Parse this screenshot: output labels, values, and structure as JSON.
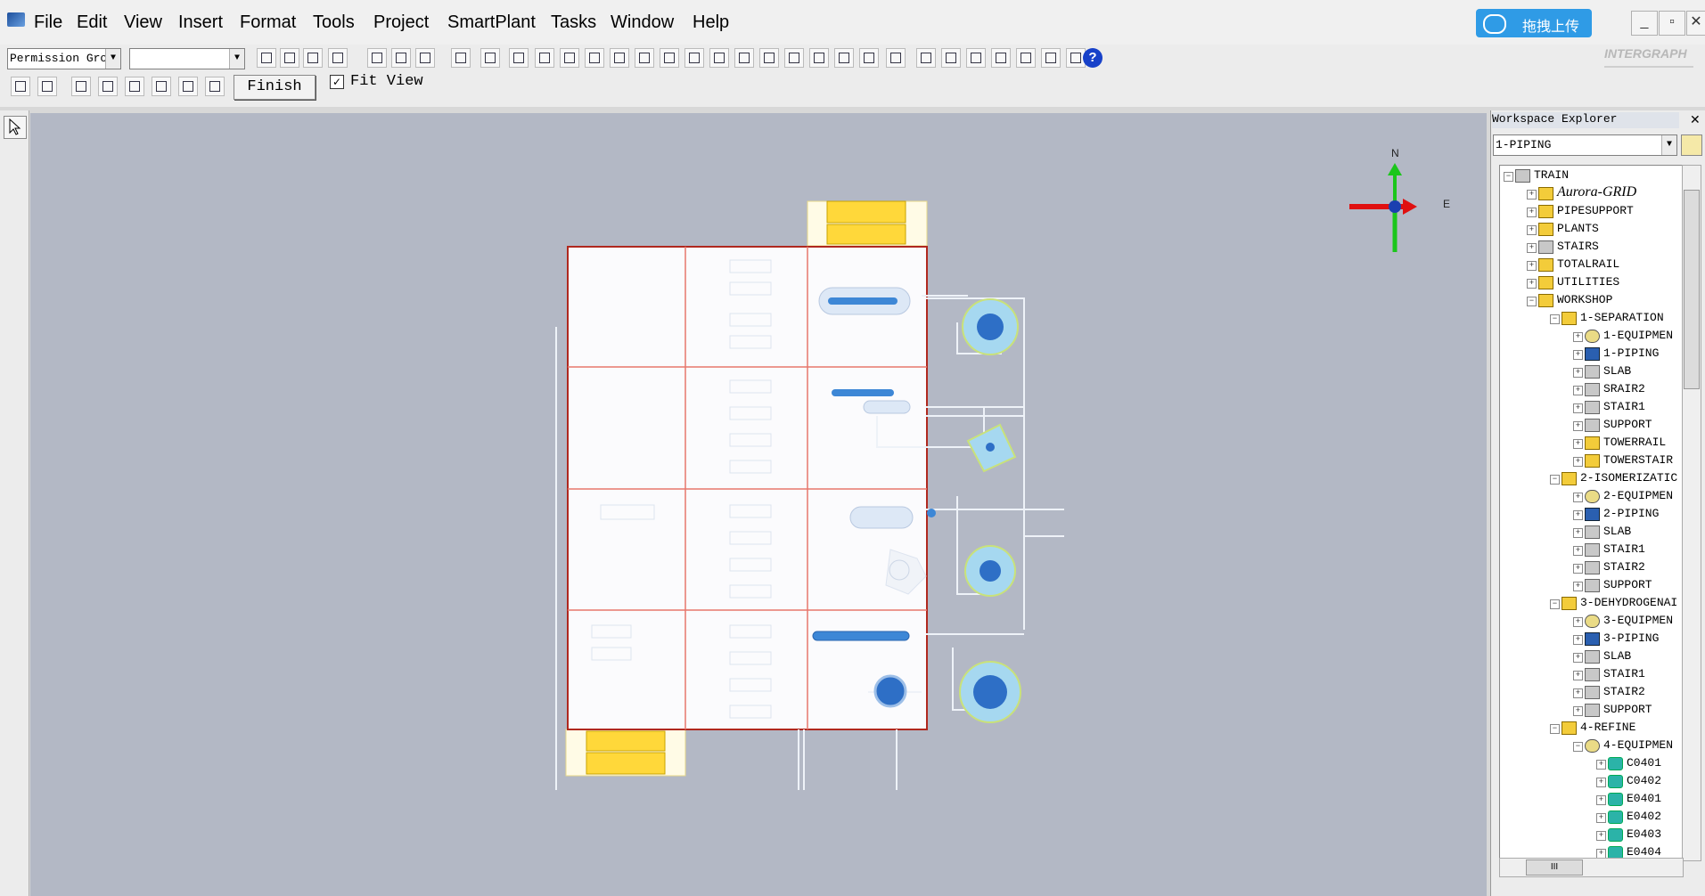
{
  "menubar": {
    "items": [
      "File",
      "Edit",
      "View",
      "Insert",
      "Format",
      "Tools",
      "Project",
      "SmartPlant",
      "Tasks",
      "Window",
      "Help"
    ],
    "upload_label": "拖拽上传",
    "window_buttons": [
      "_",
      "▫",
      "✕"
    ]
  },
  "toolbar1": {
    "permission_group": "Permission Gro",
    "second_combo": "",
    "brand": "INTERGRAPH"
  },
  "toolbar2": {
    "finish_label": "Finish",
    "fit_view_label": "Fit View",
    "fit_view_checked": "✓"
  },
  "compass": {
    "north": "N",
    "east": "E"
  },
  "workspace_explorer": {
    "title": "Workspace Explorer",
    "filter_value": "1-PIPING",
    "tree": [
      {
        "label": "TRAIN",
        "level": 0,
        "icon": "sys",
        "expander": "−"
      },
      {
        "label": "Aurora-GRID",
        "level": 1,
        "icon": "folder",
        "expander": "+",
        "italic": true
      },
      {
        "label": "PIPESUPPORT",
        "level": 1,
        "icon": "folder",
        "expander": "+"
      },
      {
        "label": "PLANTS",
        "level": 1,
        "icon": "folder",
        "expander": "+"
      },
      {
        "label": "STAIRS",
        "level": 1,
        "icon": "sys",
        "expander": "+"
      },
      {
        "label": "TOTALRAIL",
        "level": 1,
        "icon": "folder",
        "expander": "+"
      },
      {
        "label": "UTILITIES",
        "level": 1,
        "icon": "folder",
        "expander": "+"
      },
      {
        "label": "WORKSHOP",
        "level": 1,
        "icon": "folder",
        "expander": "−"
      },
      {
        "label": "1-SEPARATION",
        "level": 2,
        "icon": "folder",
        "expander": "−"
      },
      {
        "label": "1-EQUIPMEN",
        "level": 3,
        "icon": "gear",
        "expander": "+"
      },
      {
        "label": "1-PIPING",
        "level": 3,
        "icon": "pipe",
        "expander": "+"
      },
      {
        "label": "SLAB",
        "level": 3,
        "icon": "sys",
        "expander": "+"
      },
      {
        "label": "SRAIR2",
        "level": 3,
        "icon": "sys",
        "expander": "+"
      },
      {
        "label": "STAIR1",
        "level": 3,
        "icon": "sys",
        "expander": "+"
      },
      {
        "label": "SUPPORT",
        "level": 3,
        "icon": "sys",
        "expander": "+"
      },
      {
        "label": "TOWERRAIL",
        "level": 3,
        "icon": "folder",
        "expander": "+"
      },
      {
        "label": "TOWERSTAIR",
        "level": 3,
        "icon": "folder",
        "expander": "+"
      },
      {
        "label": "2-ISOMERIZATIC",
        "level": 2,
        "icon": "folder",
        "expander": "−"
      },
      {
        "label": "2-EQUIPMEN",
        "level": 3,
        "icon": "gear",
        "expander": "+"
      },
      {
        "label": "2-PIPING",
        "level": 3,
        "icon": "pipe",
        "expander": "+"
      },
      {
        "label": "SLAB",
        "level": 3,
        "icon": "sys",
        "expander": "+"
      },
      {
        "label": "STAIR1",
        "level": 3,
        "icon": "sys",
        "expander": "+"
      },
      {
        "label": "STAIR2",
        "level": 3,
        "icon": "sys",
        "expander": "+"
      },
      {
        "label": "SUPPORT",
        "level": 3,
        "icon": "sys",
        "expander": "+"
      },
      {
        "label": "3-DEHYDROGENAI",
        "level": 2,
        "icon": "folder",
        "expander": "−"
      },
      {
        "label": "3-EQUIPMEN",
        "level": 3,
        "icon": "gear",
        "expander": "+"
      },
      {
        "label": "3-PIPING",
        "level": 3,
        "icon": "pipe",
        "expander": "+"
      },
      {
        "label": "SLAB",
        "level": 3,
        "icon": "sys",
        "expander": "+"
      },
      {
        "label": "STAIR1",
        "level": 3,
        "icon": "sys",
        "expander": "+"
      },
      {
        "label": "STAIR2",
        "level": 3,
        "icon": "sys",
        "expander": "+"
      },
      {
        "label": "SUPPORT",
        "level": 3,
        "icon": "sys",
        "expander": "+"
      },
      {
        "label": "4-REFINE",
        "level": 2,
        "icon": "folder",
        "expander": "−"
      },
      {
        "label": "4-EQUIPMEN",
        "level": 3,
        "icon": "gear",
        "expander": "−"
      },
      {
        "label": "C0401",
        "level": 4,
        "icon": "equip",
        "expander": "+"
      },
      {
        "label": "C0402",
        "level": 4,
        "icon": "equip",
        "expander": "+"
      },
      {
        "label": "E0401",
        "level": 4,
        "icon": "equip",
        "expander": "+"
      },
      {
        "label": "E0402",
        "level": 4,
        "icon": "equip",
        "expander": "+"
      },
      {
        "label": "E0403",
        "level": 4,
        "icon": "equip",
        "expander": "+"
      },
      {
        "label": "E0404",
        "level": 4,
        "icon": "equip",
        "expander": "+"
      }
    ],
    "hscroll_thumb": "III"
  },
  "colors": {
    "canvas_bg": "#b3b8c5",
    "structure_outline": "#b0281e",
    "grid_line": "#e8776c",
    "platform_yellow": "#ffd83a",
    "vessel_blue": "#3d87d6",
    "upload_blue": "#2f9be6"
  }
}
